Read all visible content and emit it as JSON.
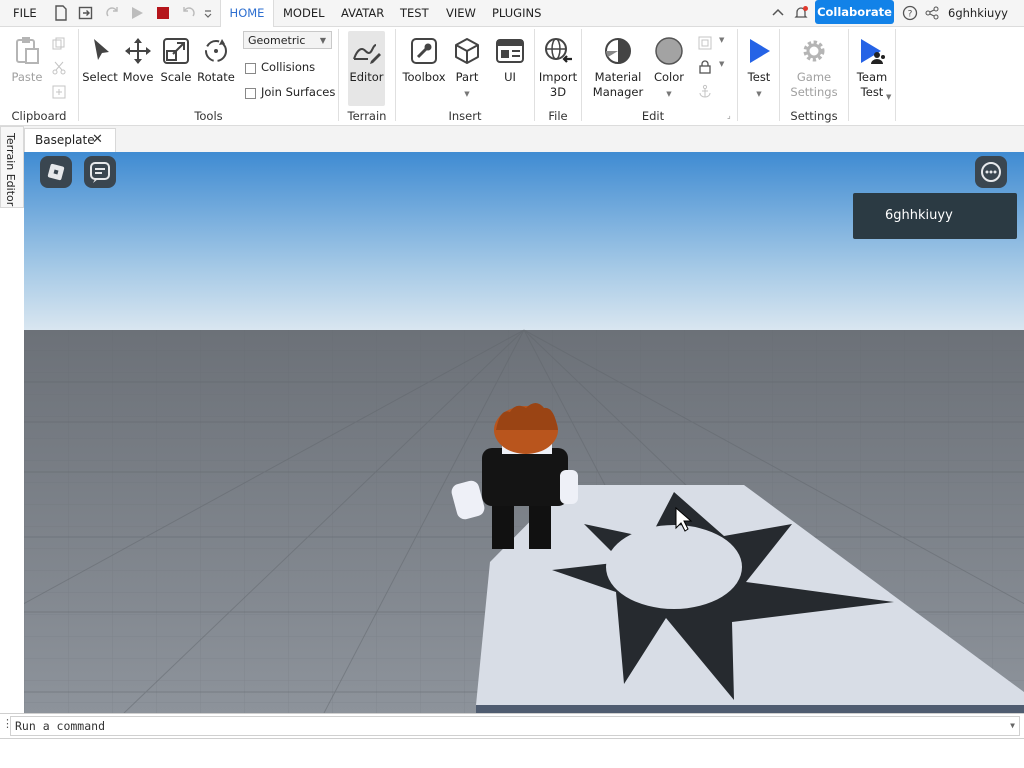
{
  "menubar": {
    "file": "FILE",
    "tabs": [
      {
        "label": "HOME",
        "active": true
      },
      {
        "label": "MODEL"
      },
      {
        "label": "AVATAR"
      },
      {
        "label": "TEST"
      },
      {
        "label": "VIEW"
      },
      {
        "label": "PLUGINS"
      }
    ],
    "collaborate": "Collaborate",
    "username": "6ghhkiuyy",
    "accent": "#1282e8"
  },
  "ribbon": {
    "clipboard": {
      "paste": "Paste",
      "group": "Clipboard"
    },
    "tools": {
      "select": "Select",
      "move": "Move",
      "scale": "Scale",
      "rotate": "Rotate",
      "mode": "Geometric",
      "collisions": "Collisions",
      "join_surfaces": "Join Surfaces",
      "group": "Tools"
    },
    "terrain": {
      "editor": "Editor",
      "group": "Terrain"
    },
    "insert": {
      "toolbox": "Toolbox",
      "part": "Part",
      "ui": "UI",
      "group": "Insert"
    },
    "file": {
      "import_line1": "Import",
      "import_line2": "3D",
      "group": "File"
    },
    "edit": {
      "material_line1": "Material",
      "material_line2": "Manager",
      "color": "Color",
      "group": "Edit"
    },
    "test": {
      "test": "Test"
    },
    "settings": {
      "game_line1": "Game",
      "game_line2": "Settings",
      "group": "Settings"
    },
    "team": {
      "line1": "Team",
      "line2": "Test"
    }
  },
  "sidebar": {
    "terrain_editor": "Terrain Editor"
  },
  "document_tabs": [
    {
      "label": "Baseplate"
    }
  ],
  "viewport": {
    "player_name": "6ghhkiuyy"
  },
  "command_bar": {
    "placeholder": "Run a command"
  }
}
